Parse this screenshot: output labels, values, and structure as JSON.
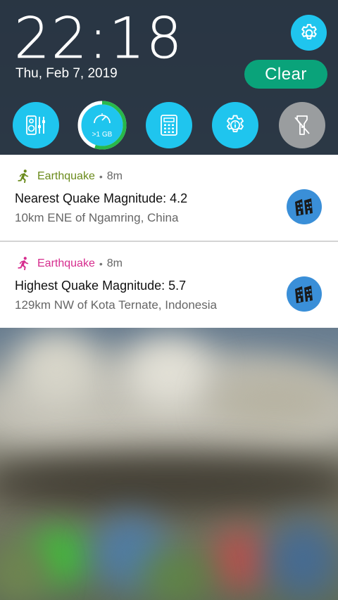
{
  "status": {
    "time": "22:18",
    "date": "Thu, Feb 7, 2019"
  },
  "actions": {
    "clear_label": "Clear",
    "settings_icon": "gear-icon"
  },
  "quick_settings": [
    {
      "name": "audio-wizard",
      "icon": "speaker-equalizer-icon",
      "enabled": true
    },
    {
      "name": "data-usage",
      "icon": "speedometer-icon",
      "label": ">1 GB",
      "enabled": true,
      "progress": 0.55
    },
    {
      "name": "calculator",
      "icon": "calculator-icon",
      "enabled": true
    },
    {
      "name": "system-info",
      "icon": "info-gear-icon",
      "enabled": true
    },
    {
      "name": "flashlight",
      "icon": "flashlight-off-icon",
      "enabled": false
    }
  ],
  "notifications": [
    {
      "app": "Earthquake",
      "time": "8m",
      "title": "Nearest Quake Magnitude: 4.2",
      "subtitle": "10km ENE of Ngamring, China",
      "accent": "#6b8b1c"
    },
    {
      "app": "Earthquake",
      "time": "8m",
      "title": "Highest Quake Magnitude: 5.7",
      "subtitle": "129km NW of Kota Ternate, Indonesia",
      "accent": "#d62d8e"
    }
  ],
  "colors": {
    "quick_setting": "#1fc5ee",
    "clear_button": "#0aa37a",
    "thumb": "#3a8fd8"
  }
}
